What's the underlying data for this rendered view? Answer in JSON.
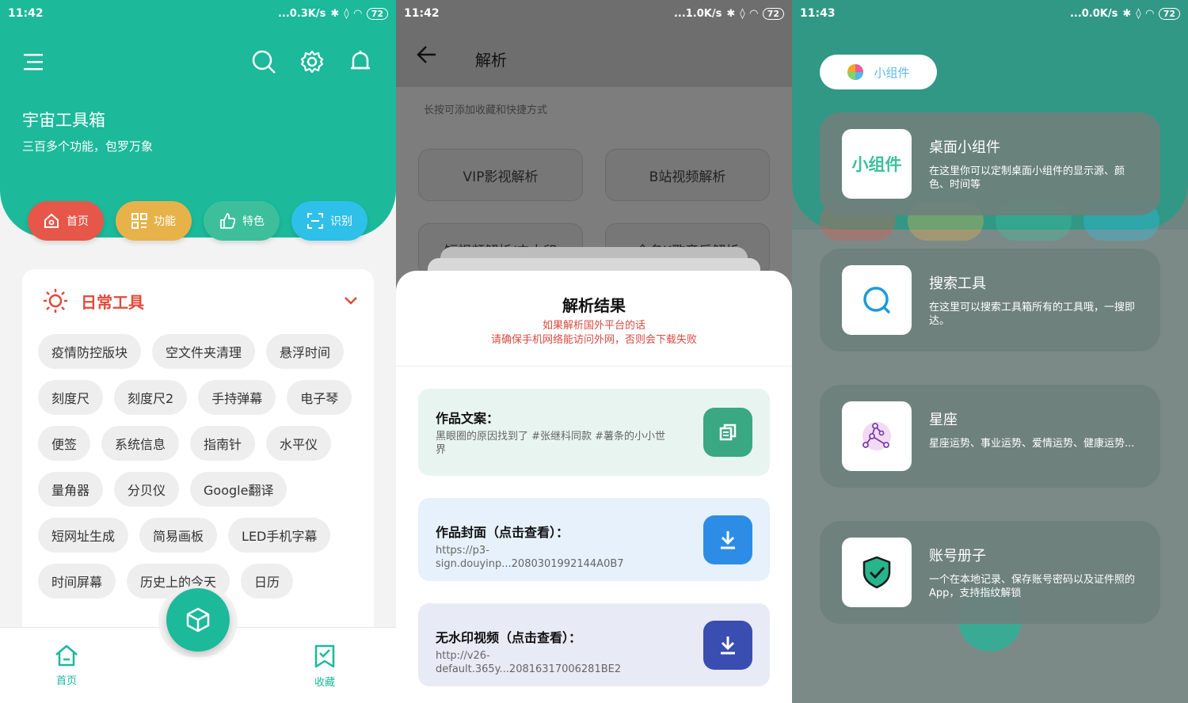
{
  "screen1": {
    "status": {
      "time": "11:42",
      "speed": "...0.3K/s",
      "battery": "72"
    },
    "title": "宇宙工具箱",
    "subtitle": "三百多个功能，包罗万象",
    "pills": [
      {
        "label": "首页",
        "color": "#e6574a"
      },
      {
        "label": "功能",
        "color": "#e7b24a"
      },
      {
        "label": "特色",
        "color": "#3dbf9c"
      },
      {
        "label": "识别",
        "color": "#2ec0e8"
      }
    ],
    "section_title": "日常工具",
    "chips": [
      "疫情防控版块",
      "空文件夹清理",
      "悬浮时间",
      "刻度尺",
      "刻度尺2",
      "手持弹幕",
      "电子琴",
      "便签",
      "系统信息",
      "指南针",
      "水平仪",
      "量角器",
      "分贝仪",
      "Google翻译",
      "短网址生成",
      "简易画板",
      "LED手机字幕",
      "时间屏幕",
      "历史上的今天",
      "日历"
    ],
    "nav": {
      "home": "首页",
      "favorites": "收藏"
    }
  },
  "screen2": {
    "status": {
      "time": "11:42",
      "speed": "...1.0K/s",
      "battery": "72"
    },
    "title": "解析",
    "hint": "长按可添加收藏和快捷方式",
    "buttons": [
      "VIP影视解析",
      "B站视频解析",
      "短视频解析/去水印",
      "全名K歌音乐解析"
    ],
    "sheet": {
      "title": "解析结果",
      "warn1": "如果解析国外平台的话",
      "warn2": "请确保手机网络能访问外网，否则会下载失败",
      "items": [
        {
          "label": "作品文案：",
          "value": "黑眼圈的原因找到了 #张继科同款 #薯条的小小世界",
          "bg": "#e8f4f0",
          "btn": "#3aa882"
        },
        {
          "label": "作品封面（点击查看）：",
          "value": "https://p3-sign.douyinp...2080301992144A0B7",
          "bg": "#e6f1fb",
          "btn": "#2d8de6"
        },
        {
          "label": "无水印视频（点击查看）：",
          "value": "http://v26-default.365y...20816317006281BE2",
          "bg": "#e8eaf6",
          "btn": "#3a4db0"
        }
      ]
    }
  },
  "screen3": {
    "status": {
      "time": "11:43",
      "speed": "...0.0K/s",
      "battery": "72"
    },
    "top_pill": "小组件",
    "cards": [
      {
        "icon_text": "小组件",
        "title": "桌面小组件",
        "desc": "在这里你可以定制桌面小组件的显示源、颜色、时间等"
      },
      {
        "title": "搜索工具",
        "desc": "在这里可以搜索工具箱所有的工具哦，一搜即达。"
      },
      {
        "title": "星座",
        "desc": "星座运势、事业运势、爱情运势、健康运势..."
      },
      {
        "title": "账号册子",
        "desc": "一个在本地记录、保存账号密码以及证件照的App，支持指纹解锁"
      }
    ]
  }
}
